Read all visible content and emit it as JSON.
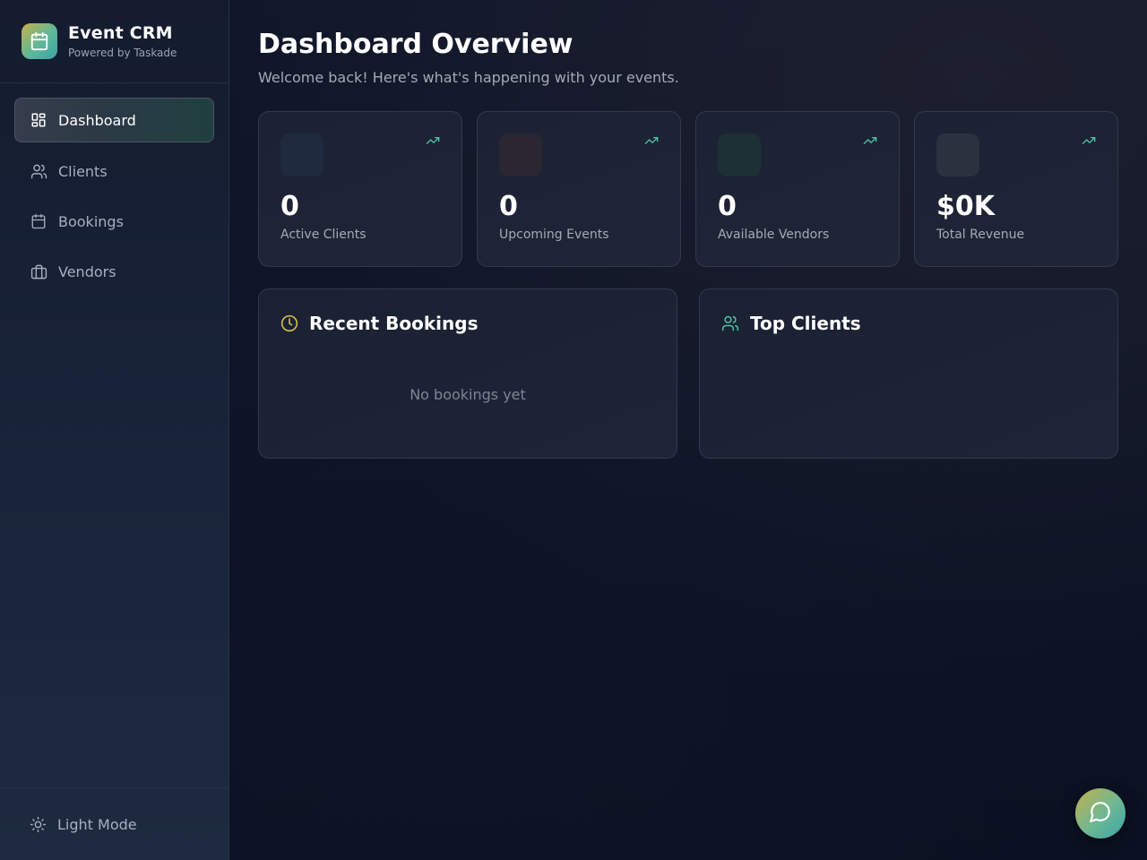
{
  "brand": {
    "title": "Event CRM",
    "subtitle": "Powered by Taskade"
  },
  "sidebar": {
    "items": [
      {
        "label": "Dashboard",
        "icon": "layout-grid-icon",
        "active": true
      },
      {
        "label": "Clients",
        "icon": "users-icon",
        "active": false
      },
      {
        "label": "Bookings",
        "icon": "calendar-icon",
        "active": false
      },
      {
        "label": "Vendors",
        "icon": "briefcase-icon",
        "active": false
      }
    ],
    "footer": {
      "label": "Light Mode",
      "icon": "sun-icon"
    }
  },
  "header": {
    "title": "Dashboard Overview",
    "subtitle": "Welcome back! Here's what's happening with your events."
  },
  "stats": [
    {
      "value": "0",
      "label": "Active Clients",
      "icon_bg": "#1e2a3d"
    },
    {
      "value": "0",
      "label": "Upcoming Events",
      "icon_bg": "#2a2632"
    },
    {
      "value": "0",
      "label": "Available Vendors",
      "icon_bg": "#1c3036"
    },
    {
      "value": "$0K",
      "label": "Total Revenue",
      "icon_bg": "#2c3140"
    }
  ],
  "panels": {
    "recent_bookings": {
      "title": "Recent Bookings",
      "empty": "No bookings yet",
      "icon": "clock-icon"
    },
    "top_clients": {
      "title": "Top Clients",
      "icon": "users-icon"
    }
  },
  "colors": {
    "accent_gold": "#d4b84a",
    "accent_teal": "#4fc3a1",
    "background": "#0c1222"
  }
}
